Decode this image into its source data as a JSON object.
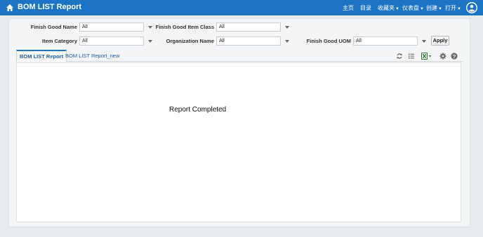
{
  "header": {
    "title": "BOM LIST Report",
    "nav": [
      {
        "label": "主页",
        "caret": false
      },
      {
        "label": "目录",
        "caret": false
      },
      {
        "label": "收藏夹",
        "caret": true
      },
      {
        "label": "仪表盘",
        "caret": true
      },
      {
        "label": "创建",
        "caret": true
      },
      {
        "label": "打开",
        "caret": true
      }
    ],
    "brand_color": "#1d74c4"
  },
  "filters": {
    "finish_good_name": {
      "label": "Finish Good Name",
      "value": "All"
    },
    "finish_good_item_class": {
      "label": "Finish Good Item Class",
      "value": "All"
    },
    "item_category": {
      "label": "Item Category",
      "value": "All"
    },
    "organization_name": {
      "label": "Organization Name",
      "value": "All"
    },
    "finish_good_uom": {
      "label": "Finish Good UOM",
      "value": "All"
    },
    "apply_label": "Apply"
  },
  "tabs": [
    {
      "label": "BOM LIST Report",
      "active": true
    },
    {
      "label": "BOM LIST Report_new",
      "active": false
    }
  ],
  "toolbar_icons": [
    "refresh-icon",
    "list-icon",
    "excel-export-icon",
    "settings-gear-icon",
    "help-icon"
  ],
  "report": {
    "status": "Report Completed"
  }
}
